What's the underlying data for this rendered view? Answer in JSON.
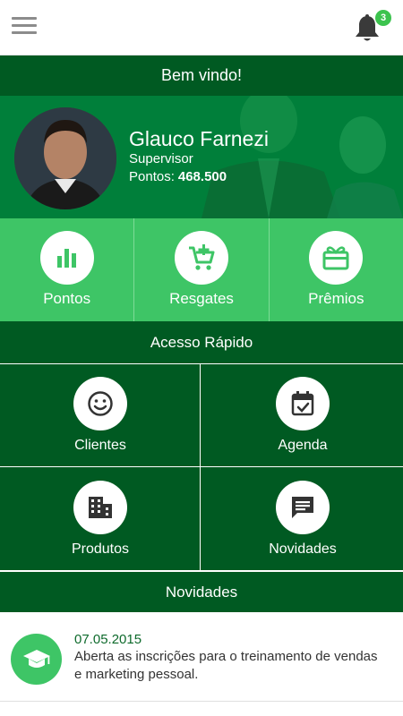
{
  "colors": {
    "dark_green": "#005a22",
    "mid_green": "#007f3a",
    "light_green": "#3ec566",
    "badge_green": "#3cc34e"
  },
  "topbar": {
    "menu_icon": "hamburger-menu-icon",
    "notification_icon": "bell-icon",
    "notification_count": "3"
  },
  "welcome": "Bem vindo!",
  "profile": {
    "name": "Glauco Farnezi",
    "role": "Supervisor",
    "points_label": "Pontos:",
    "points_value": "468.500"
  },
  "actions": [
    {
      "label": "Pontos",
      "icon": "bar-chart-icon"
    },
    {
      "label": "Resgates",
      "icon": "cart-plus-icon"
    },
    {
      "label": "Prêmios",
      "icon": "gift-icon"
    }
  ],
  "quick_access": {
    "title": "Acesso Rápido",
    "items": [
      {
        "label": "Clientes",
        "icon": "smiley-icon"
      },
      {
        "label": "Agenda",
        "icon": "calendar-check-icon"
      },
      {
        "label": "Produtos",
        "icon": "building-icon"
      },
      {
        "label": "Novidades",
        "icon": "message-icon"
      }
    ]
  },
  "news": {
    "title": "Novidades",
    "items": [
      {
        "date": "07.05.2015",
        "text": "Aberta as inscrições para o treinamento de vendas e marketing pessoal.",
        "icon": "graduation-cap-icon"
      }
    ]
  }
}
